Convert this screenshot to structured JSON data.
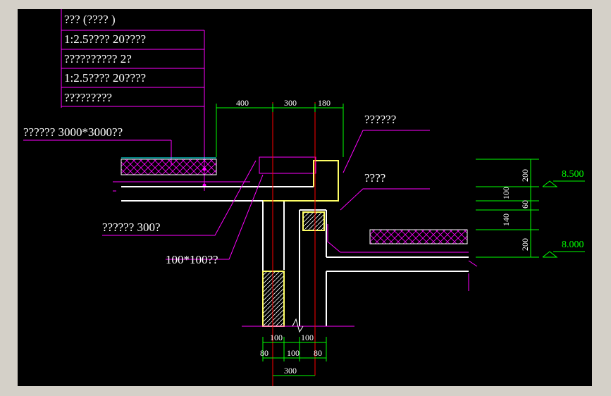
{
  "colors": {
    "background": "#000000",
    "window": "#d4d0c8",
    "leader": "#ff00ff",
    "dimension": "#00ff00",
    "axis": "#ff0000",
    "structure": "#ffff66",
    "insulation": "#ff00ff",
    "text": "#ffffff"
  },
  "layers": [
    "??? (????  )",
    "1:2.5????  20????",
    "??????????    2?",
    "1:2.5????  20????",
    "?????????"
  ],
  "annotations": {
    "grid_note": "??????   3000*3000??",
    "label_right_top": "??????",
    "label_right_mid": "????",
    "label_left_300": "??????   300?",
    "label_100x100": "100*100??"
  },
  "dimensions": {
    "top": [
      "400",
      "300",
      "180"
    ],
    "bottom_row1": [
      "100",
      "100"
    ],
    "bottom_row2": [
      "80",
      "100",
      "80"
    ],
    "bottom_total": "300",
    "right": [
      "200",
      "100",
      "60",
      "140",
      "200"
    ]
  },
  "elevations": [
    "8.500",
    "8.000"
  ]
}
